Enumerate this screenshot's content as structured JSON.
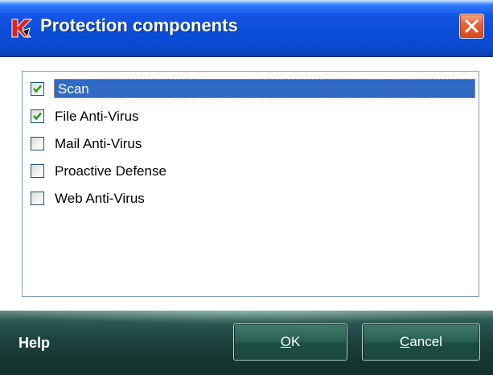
{
  "window": {
    "title": "Protection components"
  },
  "list": {
    "items": [
      {
        "label": "Scan",
        "checked": true,
        "selected": true
      },
      {
        "label": "File Anti-Virus",
        "checked": true,
        "selected": false
      },
      {
        "label": "Mail Anti-Virus",
        "checked": false,
        "selected": false
      },
      {
        "label": "Proactive Defense",
        "checked": false,
        "selected": false
      },
      {
        "label": "Web Anti-Virus",
        "checked": false,
        "selected": false
      }
    ]
  },
  "footer": {
    "help_label": "Help",
    "ok_mnemonic": "O",
    "ok_rest": "K",
    "cancel_mnemonic": "C",
    "cancel_rest": "ancel"
  },
  "icons": {
    "app": "kaspersky-k-icon",
    "close": "close-x-icon",
    "check": "checkmark-icon"
  },
  "colors": {
    "titlebar": "#0b4ed9",
    "selection": "#316ac5",
    "check": "#21a121",
    "close": "#d24a20",
    "footer": "#1f4642"
  }
}
